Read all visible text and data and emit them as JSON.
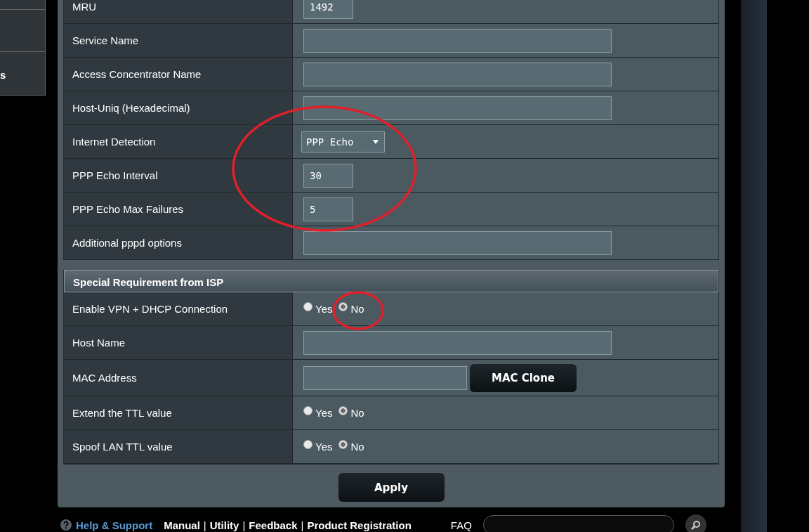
{
  "sidebar": {
    "partial_item_label": "s"
  },
  "sections": [
    {
      "rows": [
        {
          "label": "MRU",
          "kind": "number",
          "value": "1492"
        },
        {
          "label": "Service Name",
          "kind": "text",
          "value": ""
        },
        {
          "label": "Access Concentrator Name",
          "kind": "text",
          "value": ""
        },
        {
          "label": "Host-Uniq (Hexadecimal)",
          "kind": "text",
          "value": ""
        },
        {
          "label": "Internet Detection",
          "kind": "select",
          "value": "PPP Echo"
        },
        {
          "label": "PPP Echo Interval",
          "kind": "number",
          "value": "30"
        },
        {
          "label": "PPP Echo Max Failures",
          "kind": "number",
          "value": "5"
        },
        {
          "label": "Additional pppd options",
          "kind": "text",
          "value": ""
        }
      ]
    },
    {
      "title": "Special Requirement from ISP",
      "rows": [
        {
          "label": "Enable VPN + DHCP Connection",
          "kind": "radio",
          "options": [
            {
              "label": "Yes",
              "selected": false
            },
            {
              "label": "No",
              "selected": true
            }
          ]
        },
        {
          "label": "Host Name",
          "kind": "text",
          "value": ""
        },
        {
          "label": "MAC Address",
          "kind": "mac",
          "value": "",
          "button": "MAC Clone"
        },
        {
          "label": "Extend the TTL value",
          "kind": "radio",
          "options": [
            {
              "label": "Yes",
              "selected": false
            },
            {
              "label": "No",
              "selected": true
            }
          ]
        },
        {
          "label": "Spoof LAN TTL value",
          "kind": "radio",
          "options": [
            {
              "label": "Yes",
              "selected": false
            },
            {
              "label": "No",
              "selected": true
            }
          ]
        }
      ]
    }
  ],
  "apply_button": "Apply",
  "footer": {
    "help_link": "Help & Support",
    "separator": "|",
    "links": [
      "Manual",
      "Utility",
      "Feedback",
      "Product Registration"
    ],
    "faq_label": "FAQ"
  }
}
